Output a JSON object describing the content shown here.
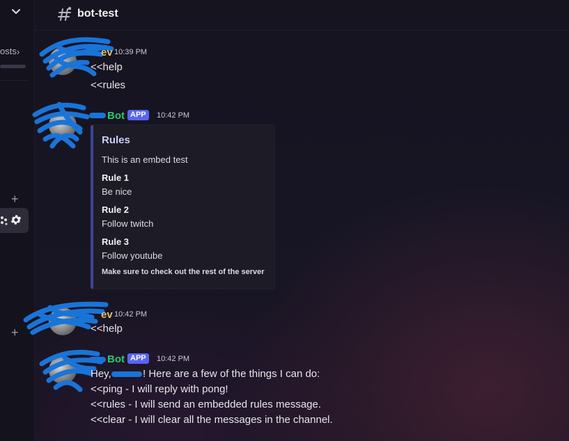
{
  "sidebar": {
    "row_label": "osts",
    "chevron": "chevron-right-icon"
  },
  "header": {
    "channel_name": "bot-test",
    "icon": "text-channel-icon"
  },
  "messages": [
    {
      "author_visible": "ev",
      "timestamp": "10:39 PM",
      "lines": [
        "<<help",
        "<<rules"
      ]
    },
    {
      "author_visible": "Bot",
      "badge": "APP",
      "timestamp": "10:42 PM",
      "embed": {
        "title": "Rules",
        "description": "This is an embed test",
        "fields": [
          {
            "name": "Rule 1",
            "value": "Be nice"
          },
          {
            "name": "Rule 2",
            "value": "Follow twitch"
          },
          {
            "name": "Rule 3",
            "value": "Follow youtube"
          }
        ],
        "footer": "Make sure to check out the rest of the server",
        "accent_color": "#3f4591"
      }
    },
    {
      "author_visible": "ev",
      "timestamp": "10:42 PM",
      "lines": [
        "<<help"
      ]
    },
    {
      "author_visible": "Bot",
      "badge": "APP",
      "timestamp": "10:42 PM",
      "lines": [
        "Hey,",
        "! Here are a few of the things I can do:",
        "<<ping - I will reply with pong!",
        "<<rules - I will send an embedded rules message.",
        "<<clear - I will clear all the messages in the channel."
      ]
    }
  ],
  "colors": {
    "bot_name": "#2dc770",
    "user_name": "#e1c36a",
    "app_badge": "#5865f2",
    "redaction": "#1a74d8"
  }
}
